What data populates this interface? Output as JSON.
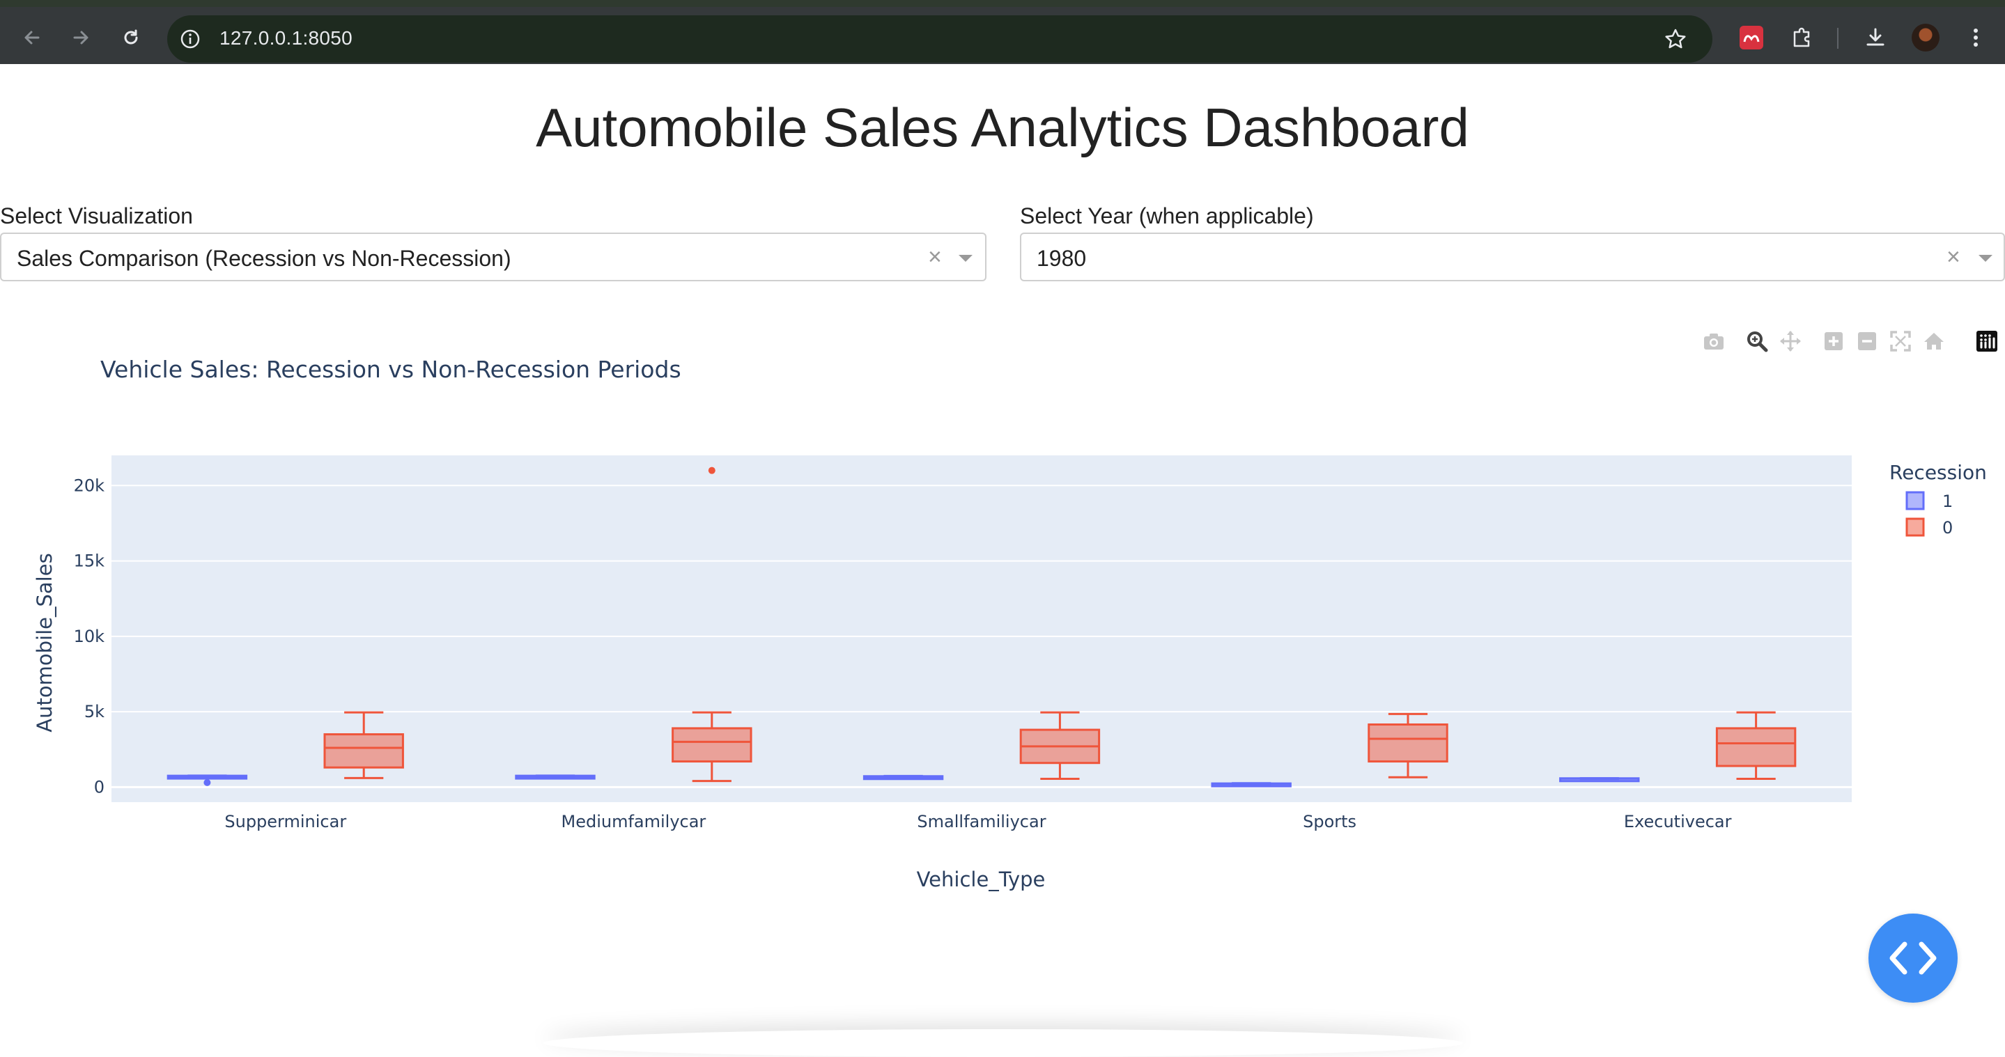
{
  "browser": {
    "url": "127.0.0.1:8050"
  },
  "page": {
    "title": "Automobile Sales Analytics Dashboard"
  },
  "controls": {
    "visualization": {
      "label": "Select Visualization",
      "value": "Sales Comparison (Recession vs Non-Recession)",
      "clear": "×"
    },
    "year": {
      "label": "Select Year (when applicable)",
      "value": "1980",
      "clear": "×"
    }
  },
  "chart_data": {
    "type": "box",
    "title": "Vehicle Sales: Recession vs Non-Recession Periods",
    "xlabel": "Vehicle_Type",
    "ylabel": "Automobile_Sales",
    "ylim": [
      -1000,
      22000
    ],
    "yticks": [
      0,
      5000,
      10000,
      15000,
      20000
    ],
    "ytick_labels": [
      "0",
      "5k",
      "10k",
      "15k",
      "20k"
    ],
    "categories": [
      "Supperminicar",
      "Mediumfamilycar",
      "Smallfamiliycar",
      "Sports",
      "Executivecar"
    ],
    "grid": true,
    "legend": {
      "title": "Recession",
      "placement": "top-right"
    },
    "series": [
      {
        "name": "1",
        "color": "#636efa",
        "boxes": [
          {
            "min": 580,
            "q1": 620,
            "median": 680,
            "q3": 750,
            "max": 760,
            "outliers": [
              300
            ]
          },
          {
            "min": 600,
            "q1": 640,
            "median": 690,
            "q3": 750,
            "max": 760,
            "outliers": []
          },
          {
            "min": 560,
            "q1": 600,
            "median": 660,
            "q3": 720,
            "max": 740,
            "outliers": []
          },
          {
            "min": 150,
            "q1": 170,
            "median": 200,
            "q3": 240,
            "max": 260,
            "outliers": []
          },
          {
            "min": 540,
            "q1": 550,
            "median": 560,
            "q3": 580,
            "max": 590,
            "outliers": []
          }
        ]
      },
      {
        "name": "0",
        "color": "#ef553b",
        "boxes": [
          {
            "min": 600,
            "q1": 1300,
            "median": 2600,
            "q3": 3500,
            "max": 4950,
            "outliers": []
          },
          {
            "min": 400,
            "q1": 1700,
            "median": 3000,
            "q3": 3900,
            "max": 4950,
            "outliers": [
              21000
            ]
          },
          {
            "min": 550,
            "q1": 1600,
            "median": 2700,
            "q3": 3800,
            "max": 4950,
            "outliers": []
          },
          {
            "min": 650,
            "q1": 1700,
            "median": 3200,
            "q3": 4150,
            "max": 4850,
            "outliers": []
          },
          {
            "min": 550,
            "q1": 1400,
            "median": 2900,
            "q3": 3900,
            "max": 4950,
            "outliers": []
          }
        ]
      }
    ]
  },
  "icons": {
    "modebar": [
      "camera-icon",
      "zoom-icon",
      "pan-icon",
      "zoom-in-icon",
      "zoom-out-icon",
      "autoscale-icon",
      "reset-axes-icon",
      "plotly-logo-icon"
    ],
    "fab": "code-icon"
  }
}
